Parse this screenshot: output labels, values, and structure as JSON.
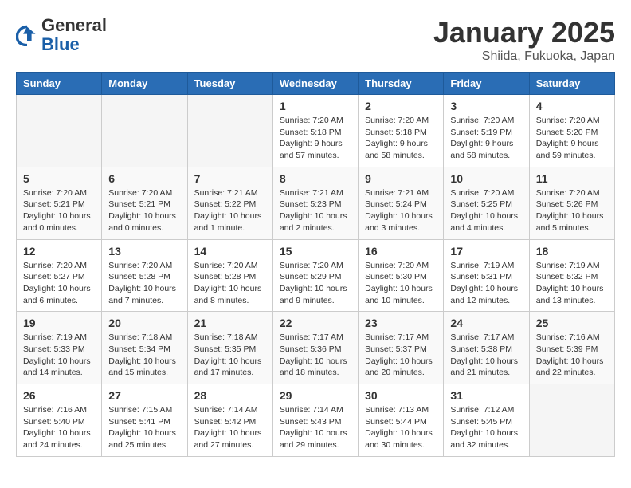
{
  "header": {
    "logo_general": "General",
    "logo_blue": "Blue",
    "month_title": "January 2025",
    "location": "Shiida, Fukuoka, Japan"
  },
  "weekdays": [
    "Sunday",
    "Monday",
    "Tuesday",
    "Wednesday",
    "Thursday",
    "Friday",
    "Saturday"
  ],
  "weeks": [
    [
      {
        "day": "",
        "info": ""
      },
      {
        "day": "",
        "info": ""
      },
      {
        "day": "",
        "info": ""
      },
      {
        "day": "1",
        "info": "Sunrise: 7:20 AM\nSunset: 5:18 PM\nDaylight: 9 hours\nand 57 minutes."
      },
      {
        "day": "2",
        "info": "Sunrise: 7:20 AM\nSunset: 5:18 PM\nDaylight: 9 hours\nand 58 minutes."
      },
      {
        "day": "3",
        "info": "Sunrise: 7:20 AM\nSunset: 5:19 PM\nDaylight: 9 hours\nand 58 minutes."
      },
      {
        "day": "4",
        "info": "Sunrise: 7:20 AM\nSunset: 5:20 PM\nDaylight: 9 hours\nand 59 minutes."
      }
    ],
    [
      {
        "day": "5",
        "info": "Sunrise: 7:20 AM\nSunset: 5:21 PM\nDaylight: 10 hours\nand 0 minutes."
      },
      {
        "day": "6",
        "info": "Sunrise: 7:20 AM\nSunset: 5:21 PM\nDaylight: 10 hours\nand 0 minutes."
      },
      {
        "day": "7",
        "info": "Sunrise: 7:21 AM\nSunset: 5:22 PM\nDaylight: 10 hours\nand 1 minute."
      },
      {
        "day": "8",
        "info": "Sunrise: 7:21 AM\nSunset: 5:23 PM\nDaylight: 10 hours\nand 2 minutes."
      },
      {
        "day": "9",
        "info": "Sunrise: 7:21 AM\nSunset: 5:24 PM\nDaylight: 10 hours\nand 3 minutes."
      },
      {
        "day": "10",
        "info": "Sunrise: 7:20 AM\nSunset: 5:25 PM\nDaylight: 10 hours\nand 4 minutes."
      },
      {
        "day": "11",
        "info": "Sunrise: 7:20 AM\nSunset: 5:26 PM\nDaylight: 10 hours\nand 5 minutes."
      }
    ],
    [
      {
        "day": "12",
        "info": "Sunrise: 7:20 AM\nSunset: 5:27 PM\nDaylight: 10 hours\nand 6 minutes."
      },
      {
        "day": "13",
        "info": "Sunrise: 7:20 AM\nSunset: 5:28 PM\nDaylight: 10 hours\nand 7 minutes."
      },
      {
        "day": "14",
        "info": "Sunrise: 7:20 AM\nSunset: 5:28 PM\nDaylight: 10 hours\nand 8 minutes."
      },
      {
        "day": "15",
        "info": "Sunrise: 7:20 AM\nSunset: 5:29 PM\nDaylight: 10 hours\nand 9 minutes."
      },
      {
        "day": "16",
        "info": "Sunrise: 7:20 AM\nSunset: 5:30 PM\nDaylight: 10 hours\nand 10 minutes."
      },
      {
        "day": "17",
        "info": "Sunrise: 7:19 AM\nSunset: 5:31 PM\nDaylight: 10 hours\nand 12 minutes."
      },
      {
        "day": "18",
        "info": "Sunrise: 7:19 AM\nSunset: 5:32 PM\nDaylight: 10 hours\nand 13 minutes."
      }
    ],
    [
      {
        "day": "19",
        "info": "Sunrise: 7:19 AM\nSunset: 5:33 PM\nDaylight: 10 hours\nand 14 minutes."
      },
      {
        "day": "20",
        "info": "Sunrise: 7:18 AM\nSunset: 5:34 PM\nDaylight: 10 hours\nand 15 minutes."
      },
      {
        "day": "21",
        "info": "Sunrise: 7:18 AM\nSunset: 5:35 PM\nDaylight: 10 hours\nand 17 minutes."
      },
      {
        "day": "22",
        "info": "Sunrise: 7:17 AM\nSunset: 5:36 PM\nDaylight: 10 hours\nand 18 minutes."
      },
      {
        "day": "23",
        "info": "Sunrise: 7:17 AM\nSunset: 5:37 PM\nDaylight: 10 hours\nand 20 minutes."
      },
      {
        "day": "24",
        "info": "Sunrise: 7:17 AM\nSunset: 5:38 PM\nDaylight: 10 hours\nand 21 minutes."
      },
      {
        "day": "25",
        "info": "Sunrise: 7:16 AM\nSunset: 5:39 PM\nDaylight: 10 hours\nand 22 minutes."
      }
    ],
    [
      {
        "day": "26",
        "info": "Sunrise: 7:16 AM\nSunset: 5:40 PM\nDaylight: 10 hours\nand 24 minutes."
      },
      {
        "day": "27",
        "info": "Sunrise: 7:15 AM\nSunset: 5:41 PM\nDaylight: 10 hours\nand 25 minutes."
      },
      {
        "day": "28",
        "info": "Sunrise: 7:14 AM\nSunset: 5:42 PM\nDaylight: 10 hours\nand 27 minutes."
      },
      {
        "day": "29",
        "info": "Sunrise: 7:14 AM\nSunset: 5:43 PM\nDaylight: 10 hours\nand 29 minutes."
      },
      {
        "day": "30",
        "info": "Sunrise: 7:13 AM\nSunset: 5:44 PM\nDaylight: 10 hours\nand 30 minutes."
      },
      {
        "day": "31",
        "info": "Sunrise: 7:12 AM\nSunset: 5:45 PM\nDaylight: 10 hours\nand 32 minutes."
      },
      {
        "day": "",
        "info": ""
      }
    ]
  ]
}
